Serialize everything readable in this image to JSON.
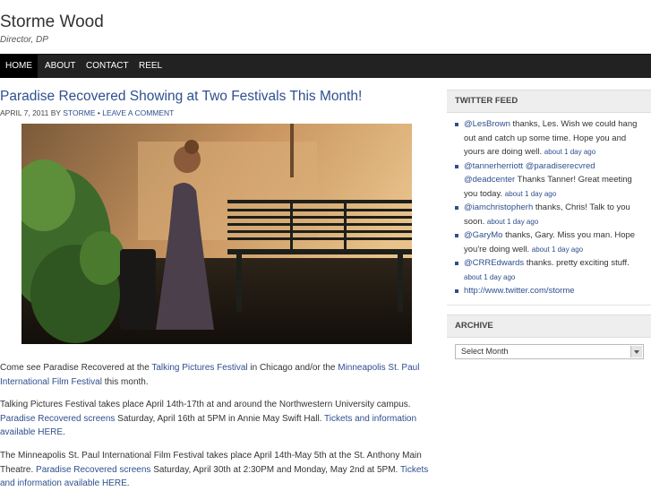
{
  "site": {
    "title": "Storme Wood",
    "description": "Director, DP"
  },
  "nav": {
    "items": [
      "HOME",
      "ABOUT",
      "CONTACT",
      "REEL"
    ]
  },
  "post": {
    "title": "Paradise Recovered Showing at Two Festivals This Month!",
    "date": "APRIL 7, 2011",
    "by": "BY",
    "author": "STORME",
    "separator": "•",
    "comment_link": "LEAVE A COMMENT",
    "p1": {
      "a": "Come see Paradise Recovered at the ",
      "link1": "Talking Pictures Festival",
      "b": " in Chicago and/or the ",
      "link2": "Minneapolis St. Paul International Film Festival",
      "c": " this month."
    },
    "p2": {
      "a": "Talking Pictures Festival takes place April 14th-17th at and around the Northwestern University campus. ",
      "link1": "Paradise Recovered screens",
      "b": " Saturday, April 16th at 5PM in Annie May Swift Hall. ",
      "link2": "Tickets and information available HERE",
      "c": "."
    },
    "p3": {
      "a": "The Minneapolis St. Paul International Film Festival takes place April 14th-May 5th at the St. Anthony Main Theatre. ",
      "link1": "Paradise Recovered screens",
      "b": " Saturday, April 30th at 2:30PM and Monday, May 2nd at 5PM. ",
      "link2": "Tickets and information available HERE",
      "c": "."
    }
  },
  "sidebar": {
    "twitter": {
      "heading": "TWITTER FEED",
      "tweets": [
        {
          "user": "@LesBrown",
          "text": " thanks, Les. Wish we could hang out and catch up some time. Hope you and yours are doing well. ",
          "time": "about 1 day ago"
        },
        {
          "user": "@tannerherriott @paradiserecvred @deadcenter",
          "text": " Thanks Tanner! Great meeting you today. ",
          "time": "about 1 day ago"
        },
        {
          "user": "@iamchristopherh",
          "text": " thanks, Chris! Talk to you soon. ",
          "time": "about 1 day ago"
        },
        {
          "user": "@GaryMo",
          "text": " thanks, Gary. Miss you man. Hope you're doing well. ",
          "time": "about 1 day ago"
        },
        {
          "user": "@CRREdwards",
          "text": " thanks. pretty exciting stuff. ",
          "time": "about 1 day ago"
        }
      ],
      "link": "http://www.twitter.com/storme"
    },
    "archive": {
      "heading": "ARCHIVE",
      "select_value": "Select Month"
    }
  },
  "colors": {
    "link": "#2e4f8f",
    "navbar": "#222222",
    "nav_active": "#000000"
  }
}
